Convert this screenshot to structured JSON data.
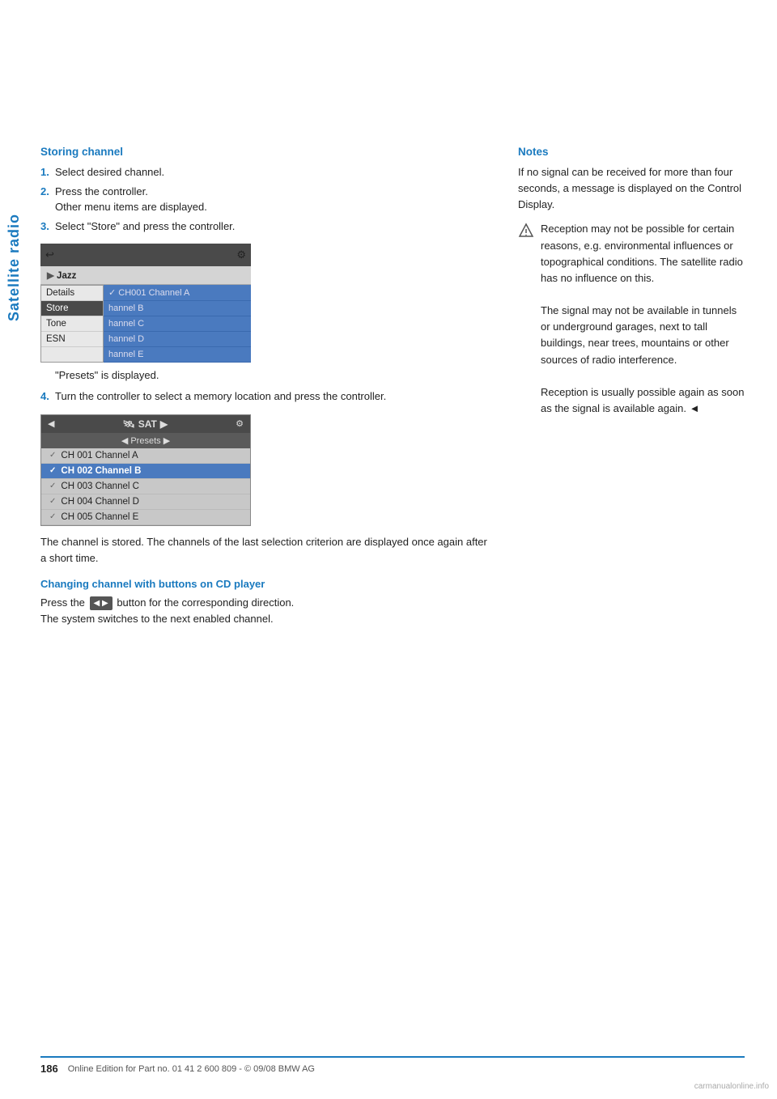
{
  "sidebar": {
    "label": "Satellite radio"
  },
  "left_column": {
    "section1": {
      "heading": "Storing channel",
      "steps": [
        {
          "num": "1.",
          "text": "Select desired channel."
        },
        {
          "num": "2.",
          "text": "Press the controller.\nOther menu items are displayed."
        },
        {
          "num": "3.",
          "text": "Select \"Store\" and press the controller."
        }
      ],
      "screen1": {
        "header_left": "↩",
        "header_right": "⚙",
        "jazz_label": "Jazz",
        "channel_main": "CH 001 Channel A",
        "menu_items": [
          "Details",
          "Store",
          "Tone",
          "ESN"
        ],
        "channels": [
          "hannel B",
          "hannel C",
          "hannel D",
          "hannel E"
        ]
      },
      "presets_note": "\"Presets\" is displayed.",
      "step4": {
        "num": "4.",
        "text": "Turn the controller to select a memory location and press the controller."
      },
      "screen2": {
        "header_arrows_left": "◀",
        "header_title": "SAT",
        "header_arrows_right": "▶",
        "header_right": "⚙",
        "presets_label": "◀ Presets ▶",
        "channels": [
          {
            "label": "CH 001 Channel A",
            "checked": true,
            "selected": false
          },
          {
            "label": "CH 002 Channel B",
            "checked": true,
            "selected": true
          },
          {
            "label": "CH 003 Channel C",
            "checked": true,
            "selected": false
          },
          {
            "label": "CH 004 Channel D",
            "checked": true,
            "selected": false
          },
          {
            "label": "CH 005 Channel E",
            "checked": true,
            "selected": false
          }
        ]
      },
      "stored_text": "The channel is stored. The channels of the last selection criterion are displayed once again after a short time."
    },
    "section2": {
      "heading": "Changing channel with buttons on CD player",
      "text1": "Press the",
      "button_label": "◀ ▶",
      "text2": "button for the corresponding direction.",
      "text3": "The system switches to the next enabled channel."
    }
  },
  "right_column": {
    "notes_heading": "Notes",
    "note1": "If no signal can be received for more than four seconds, a message is displayed on the Control Display.",
    "note2": "Reception may not be possible for certain reasons, e.g. environmental influences or topographical conditions. The satellite radio has no influence on this.\nThe signal may not be available in tunnels or underground garages, next to tall buildings, near trees, mountains or other sources of radio interference.\nReception is usually possible again as soon as the signal is available again.",
    "end_marker": "◄"
  },
  "footer": {
    "page_number": "186",
    "footer_text": "Online Edition for Part no. 01 41 2 600 809 - © 09/08 BMW AG"
  },
  "colors": {
    "accent": "#1a7abf",
    "text": "#222",
    "muted": "#555"
  }
}
